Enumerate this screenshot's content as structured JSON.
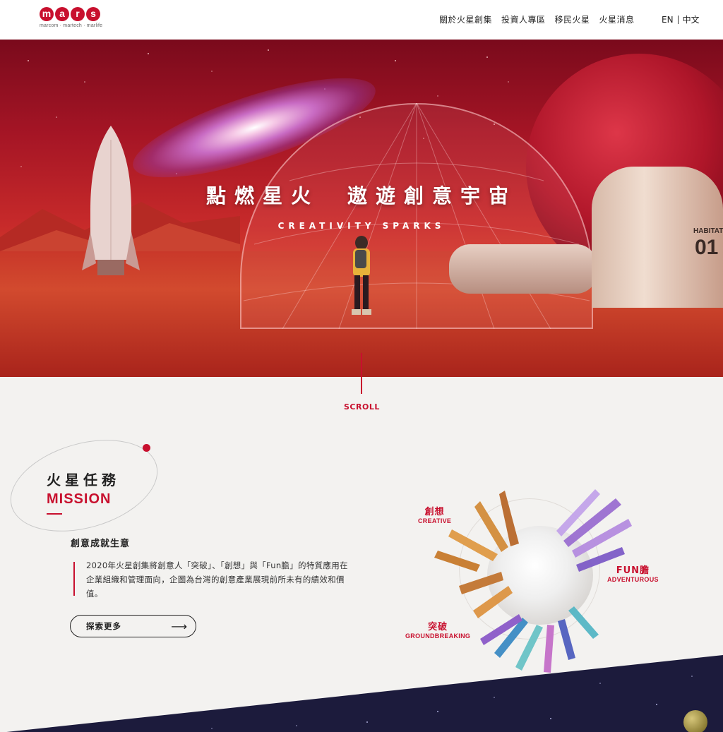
{
  "header": {
    "logo": {
      "letters": [
        "m",
        "a",
        "r",
        "s"
      ],
      "tagline": "marcom · martech · marlife"
    },
    "nav": [
      "關於火星創集",
      "投資人專區",
      "移民火星",
      "火星消息"
    ],
    "lang": {
      "en": "EN",
      "zh": "中文"
    }
  },
  "hero": {
    "title": "點燃星火　遨遊創意宇宙",
    "subtitle": "CREATIVITY SPARKS",
    "habitat_label": "HABITAT",
    "habitat_number": "01"
  },
  "scroll": {
    "label": "SCROLL"
  },
  "mission": {
    "title_zh": "火星任務",
    "title_en": "MISSION",
    "heading": "創意成就生意",
    "body": "2020年火星創集將創意人「突破」、「創想」與「Fun膽」的特質應用在企業組織和管理面向，企圖為台灣的創意產業展現前所未有的績效和價值。",
    "button_label": "探索更多",
    "button_icon": "arrow-right-icon"
  },
  "attributes": [
    {
      "zh": "創想",
      "en": "CREATIVE"
    },
    {
      "zh": "FUN膽",
      "en": "ADVENTUROUS"
    },
    {
      "zh": "突破",
      "en": "GROUNDBREAKING"
    }
  ],
  "colors": {
    "brand_red": "#c8102e",
    "space": "#1c1b3c",
    "background": "#f3f2f0"
  }
}
